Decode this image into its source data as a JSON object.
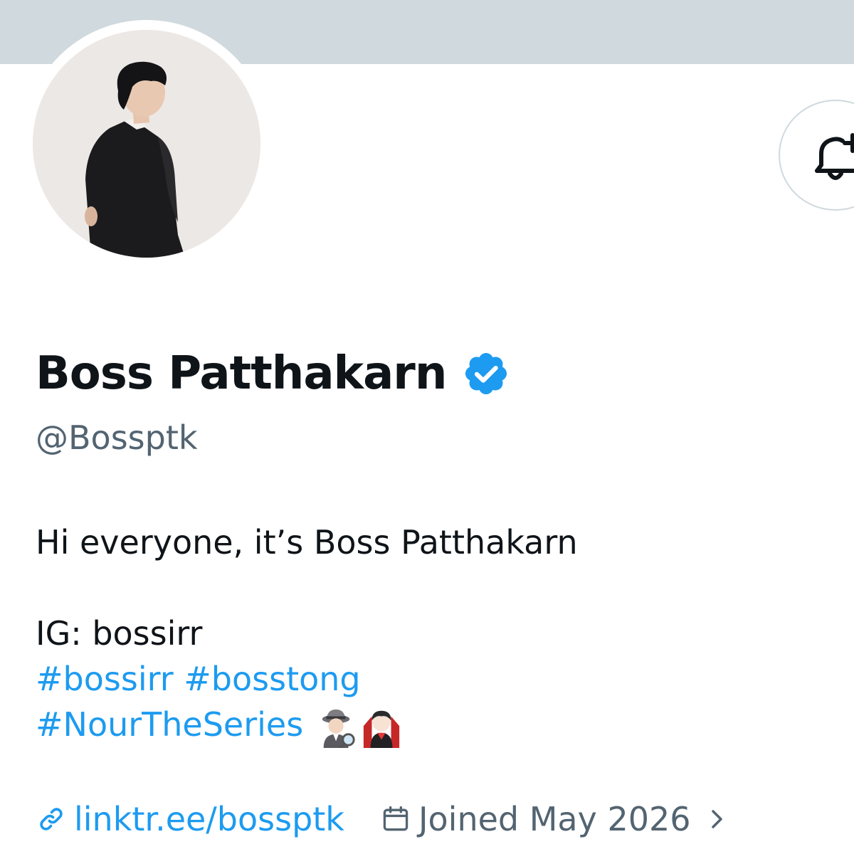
{
  "profile": {
    "display_name": "Boss Patthakarn",
    "handle": "@Bossptk",
    "verified": true
  },
  "bio": {
    "line1": "Hi everyone, it’s Boss Patthakarn",
    "line2": "IG: bossirr",
    "hashtags_line1": [
      "#bossirr",
      "#bosstong"
    ],
    "hashtags_line2": [
      "#NourTheSeries"
    ],
    "emojis": [
      "detective-emoji",
      "vampire-emoji"
    ]
  },
  "meta": {
    "link_text": "linktr.ee/bossptk",
    "joined_text": "Joined May 2026"
  },
  "icons": {
    "notify": "bell-plus-icon",
    "verified": "verified-badge-icon",
    "link": "link-icon",
    "calendar": "calendar-icon",
    "chevron": "chevron-right-icon"
  },
  "colors": {
    "accent": "#1d9bf0",
    "text_primary": "#0f1419",
    "text_secondary": "#536471",
    "banner": "#cfd9de"
  }
}
